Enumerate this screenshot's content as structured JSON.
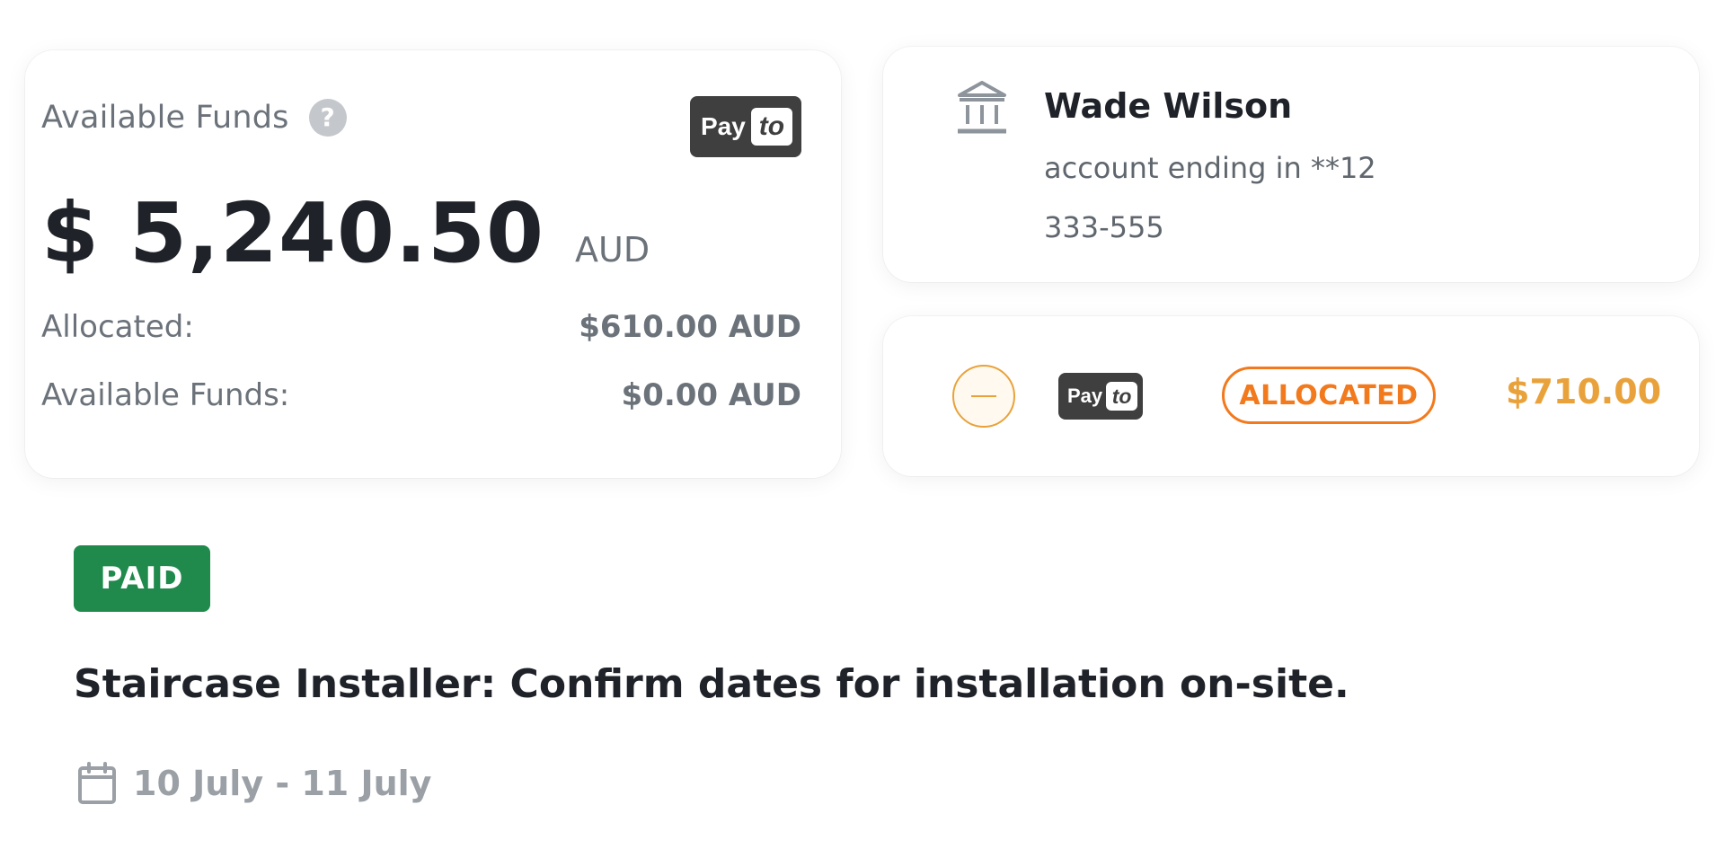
{
  "funds": {
    "title": "Available Funds",
    "help_glyph": "?",
    "badge": {
      "pay": "Pay",
      "to": "to"
    },
    "balance": "$ 5,240.50",
    "currency": "AUD",
    "rows": [
      {
        "label": "Allocated:",
        "value": "$610.00 AUD"
      },
      {
        "label": "Available Funds:",
        "value": "$0.00 AUD"
      }
    ]
  },
  "account": {
    "icon": "bank-icon",
    "name": "Wade Wilson",
    "ending": "account ending in **12",
    "bsb": "333-555"
  },
  "allocation": {
    "badge": {
      "pay": "Pay",
      "to": "to"
    },
    "status": "ALLOCATED",
    "amount": "$710.00"
  },
  "task": {
    "status": "PAID",
    "title": "Staircase Installer: Confirm dates for installation on-site.",
    "dates": "10 July - 11 July"
  },
  "colors": {
    "accent_orange": "#f2791c",
    "amount_orange": "#e9a23b",
    "paid_green": "#1f8a4c",
    "text_dark": "#1f2329",
    "text_grey": "#6b727a",
    "payto_dark": "#3f3f3f"
  }
}
